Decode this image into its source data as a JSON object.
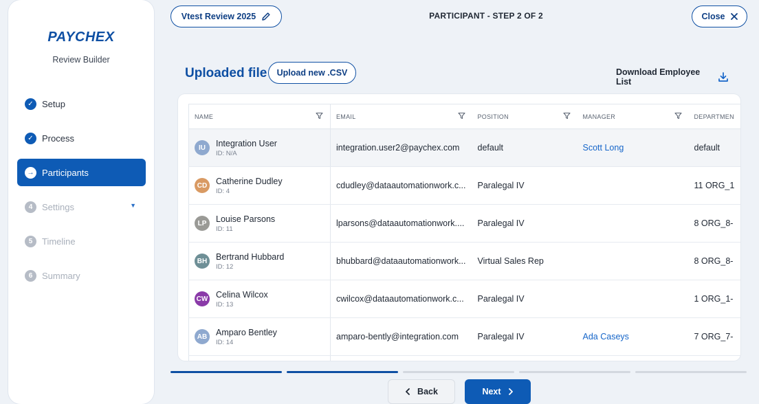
{
  "header": {
    "review_name": "Vtest Review 2025",
    "step_title": "PARTICIPANT - STEP 2 OF 2",
    "close_label": "Close"
  },
  "sidebar": {
    "brand": "PAYCHEX",
    "subtitle": "Review Builder",
    "items": [
      {
        "number": "✓",
        "label": "Setup",
        "state": "done"
      },
      {
        "number": "✓",
        "label": "Process",
        "state": "done"
      },
      {
        "number": "→",
        "label": "Participants",
        "state": "active"
      },
      {
        "number": "4",
        "label": "Settings",
        "state": "todo",
        "has_caret": true
      },
      {
        "number": "5",
        "label": "Timeline",
        "state": "todo"
      },
      {
        "number": "6",
        "label": "Summary",
        "state": "todo"
      }
    ]
  },
  "main": {
    "section_title": "Uploaded file",
    "upload_label": "Upload new .CSV",
    "download_label": "Download Employee List"
  },
  "table": {
    "columns": [
      "NAME",
      "EMAIL",
      "POSITION",
      "MANAGER",
      "DEPARTMEN"
    ],
    "rows": [
      {
        "initials": "IU",
        "avatar_color": "#8fa9cf",
        "name": "Integration User",
        "id": "ID: N/A",
        "email": "integration.user2@paychex.com",
        "position": "default",
        "manager": "Scott Long",
        "department": "default"
      },
      {
        "initials": "CD",
        "avatar_color": "#d99a63",
        "name": "Catherine Dudley",
        "id": "ID: 4",
        "email": "cdudley@dataautomationwork.c...",
        "position": "Paralegal IV",
        "manager": "",
        "department": "11 ORG_1"
      },
      {
        "initials": "LP",
        "avatar_color": "#9a9a96",
        "name": "Louise Parsons",
        "id": "ID: 11",
        "email": "lparsons@dataautomationwork....",
        "position": "Paralegal IV",
        "manager": "",
        "department": "8 ORG_8-"
      },
      {
        "initials": "BH",
        "avatar_color": "#6e8f96",
        "name": "Bertrand Hubbard",
        "id": "ID: 12",
        "email": "bhubbard@dataautomationwork...",
        "position": "Virtual Sales Rep",
        "manager": "",
        "department": "8 ORG_8-"
      },
      {
        "initials": "CW",
        "avatar_color": "#8a3aa8",
        "name": "Celina Wilcox",
        "id": "ID: 13",
        "email": "cwilcox@dataautomationwork.c...",
        "position": "Paralegal IV",
        "manager": "",
        "department": "1 ORG_1-"
      },
      {
        "initials": "AB",
        "avatar_color": "#8fa9cf",
        "name": "Amparo Bentley",
        "id": "ID: 14",
        "email": "amparo-bently@integration.com",
        "position": "Paralegal IV",
        "manager": "Ada Caseys",
        "department": "7 ORG_7-"
      },
      {
        "initials": "",
        "avatar_color": "#ffffff",
        "name": "",
        "id": "",
        "email": "",
        "position": "",
        "manager": "",
        "department": ""
      }
    ]
  },
  "progress": {
    "total_steps": 5,
    "completed_steps": 2
  },
  "footer": {
    "back_label": "Back",
    "next_label": "Next"
  },
  "colors": {
    "primary": "#0e5bb5",
    "brand": "#0e4fa3",
    "link": "#1565c9",
    "inactive": "#d3d8df"
  }
}
